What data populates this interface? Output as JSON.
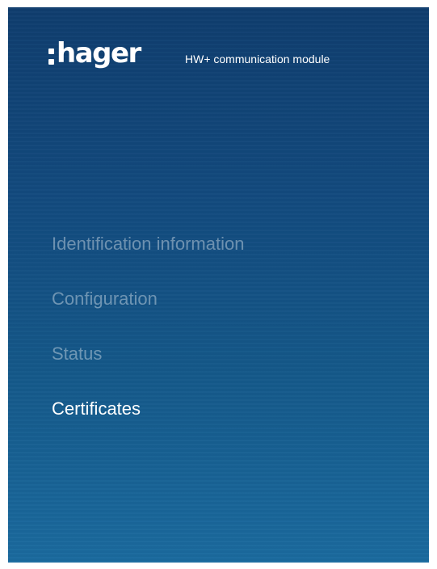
{
  "header": {
    "logo_text": "hager",
    "product_name": "HW+ communication module"
  },
  "menu": {
    "items": [
      {
        "label": "Identification information"
      },
      {
        "label": "Configuration"
      },
      {
        "label": "Status"
      },
      {
        "label": "Certificates"
      }
    ],
    "selected": "Certificates"
  },
  "colors": {
    "background_top": "#0f3d6e",
    "background_bottom": "#1a6a9e",
    "text_active": "#ffffff",
    "text_dim": "rgba(255,255,255,0.38)"
  }
}
